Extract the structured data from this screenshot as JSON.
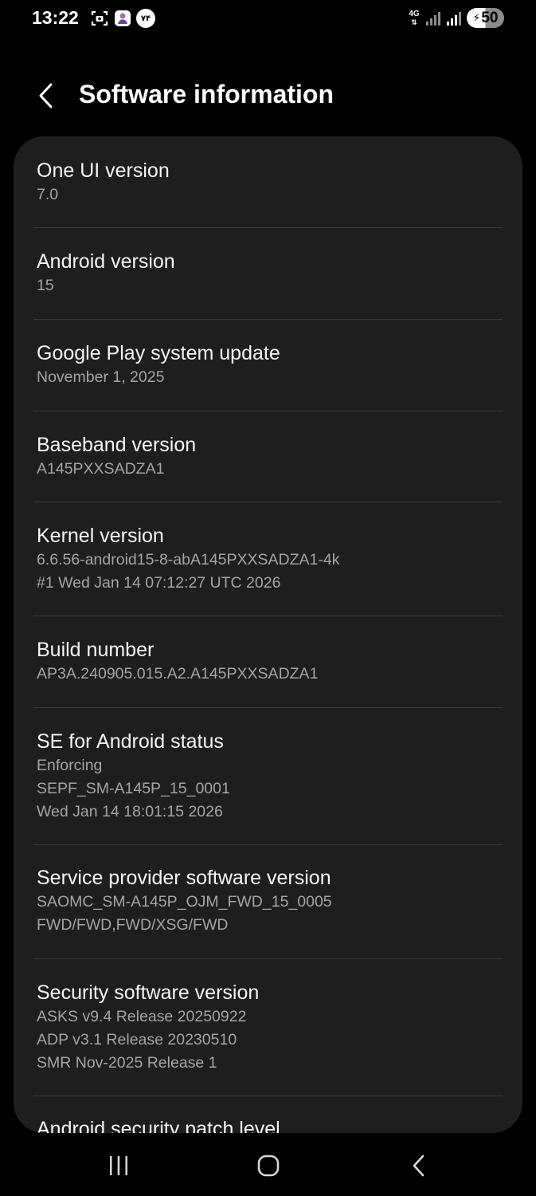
{
  "status_bar": {
    "time": "13:22",
    "notification_icons": [
      "screenshot-icon",
      "app-notification-icon",
      "badge-icon"
    ],
    "badge_text": "۷۴",
    "network_type": "4G",
    "battery_level": "50",
    "charging": true
  },
  "header": {
    "title": "Software information",
    "back_icon": "back-chevron-icon"
  },
  "items": [
    {
      "title": "One UI version",
      "lines": [
        "7.0"
      ]
    },
    {
      "title": "Android version",
      "lines": [
        "15"
      ]
    },
    {
      "title": "Google Play system update",
      "lines": [
        "November 1, 2025"
      ]
    },
    {
      "title": "Baseband version",
      "lines": [
        "A145PXXSADZA1"
      ]
    },
    {
      "title": "Kernel version",
      "lines": [
        "6.6.56-android15-8-abA145PXXSADZA1-4k",
        "#1 Wed Jan 14 07:12:27 UTC 2026"
      ]
    },
    {
      "title": "Build number",
      "lines": [
        "AP3A.240905.015.A2.A145PXXSADZA1"
      ]
    },
    {
      "title": "SE for Android status",
      "lines": [
        "Enforcing",
        "SEPF_SM-A145P_15_0001",
        "Wed Jan 14 18:01:15 2026"
      ]
    },
    {
      "title": "Service provider software version",
      "lines": [
        "SAOMC_SM-A145P_OJM_FWD_15_0005",
        "FWD/FWD,FWD/XSG/FWD"
      ]
    },
    {
      "title": "Security software version",
      "lines": [
        "ASKS v9.4  Release 20250922",
        "ADP v3.1 Release 20230510",
        "SMR Nov-2025 Release 1"
      ]
    },
    {
      "title": "Android security patch level",
      "lines": []
    }
  ],
  "nav_bar": {
    "recents_icon": "recents-icon",
    "home_icon": "home-icon",
    "back_icon": "nav-back-icon"
  },
  "colors": {
    "background": "#000000",
    "card": "#1e1e1f",
    "title_text": "#f5f5f5",
    "secondary_text": "#a4a4a6",
    "divider": "#3a3a3c"
  }
}
